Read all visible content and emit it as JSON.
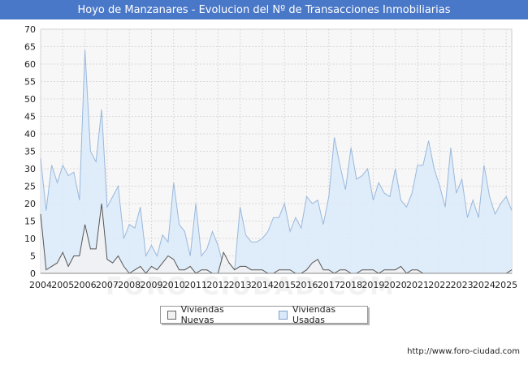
{
  "chart_data": {
    "type": "area",
    "title": "Hoyo de Manzanares - Evolucion del Nº de Transacciones Inmobiliarias",
    "xlabel": "",
    "ylabel": "",
    "ylim": [
      0,
      70
    ],
    "yticks": [
      0,
      5,
      10,
      15,
      20,
      25,
      30,
      35,
      40,
      45,
      50,
      55,
      60,
      65,
      70
    ],
    "xlim": [
      2004,
      2025.25
    ],
    "xticks": [
      "2004",
      "2005",
      "2006",
      "2007",
      "2008",
      "2009",
      "2010",
      "2011",
      "2012",
      "2013",
      "2014",
      "2015",
      "2016",
      "2017",
      "2018",
      "2019",
      "2020",
      "2021",
      "2022",
      "2023",
      "2024",
      "2025"
    ],
    "x_start": "2004 Q1",
    "frequency": "quarterly",
    "grid": true,
    "legend_position": "bottom",
    "series": [
      {
        "name": "Viviendas Nuevas",
        "color": "#555555",
        "fill": "#f2f2f2",
        "values": [
          17,
          1,
          2,
          3,
          6,
          2,
          5,
          5,
          14,
          7,
          7,
          20,
          4,
          3,
          5,
          2,
          0,
          1,
          2,
          0,
          2,
          1,
          3,
          5,
          4,
          1,
          1,
          2,
          0,
          1,
          1,
          0,
          0,
          6,
          3,
          1,
          2,
          2,
          1,
          1,
          1,
          0,
          0,
          1,
          1,
          1,
          0,
          0,
          1,
          3,
          4,
          1,
          1,
          0,
          1,
          1,
          0,
          0,
          1,
          1,
          1,
          0,
          1,
          1,
          1,
          2,
          0,
          1,
          1,
          0,
          0,
          0,
          0,
          0,
          0,
          0,
          0,
          0,
          0,
          0,
          0,
          0,
          0,
          0,
          0,
          1
        ]
      },
      {
        "name": "Viviendas Usadas",
        "color": "#9ab8dc",
        "fill": "#dbeafa",
        "values": [
          33,
          18,
          31,
          26,
          31,
          28,
          29,
          21,
          64,
          35,
          32,
          47,
          19,
          22,
          25,
          10,
          14,
          13,
          19,
          5,
          8,
          5,
          11,
          9,
          26,
          14,
          12,
          5,
          20,
          5,
          7,
          12,
          8,
          2,
          3,
          1,
          19,
          11,
          9,
          9,
          10,
          12,
          16,
          16,
          20,
          12,
          16,
          13,
          22,
          20,
          21,
          14,
          22,
          39,
          31,
          24,
          36,
          27,
          28,
          30,
          21,
          26,
          23,
          22,
          30,
          21,
          19,
          23,
          31,
          31,
          38,
          30,
          25,
          19,
          36,
          23,
          27,
          16,
          21,
          16,
          31,
          22,
          17,
          20,
          22,
          18
        ]
      }
    ]
  },
  "legend": {
    "item1": "Viviendas Nuevas",
    "item2": "Viviendas Usadas"
  },
  "footer": "http://www.foro-ciudad.com",
  "watermark": "FORO-CIUDAD.COM",
  "colors": {
    "title_bar": "#4a78c8",
    "plot_background": "#f7f7f7",
    "grid": "#d9d9d9"
  }
}
